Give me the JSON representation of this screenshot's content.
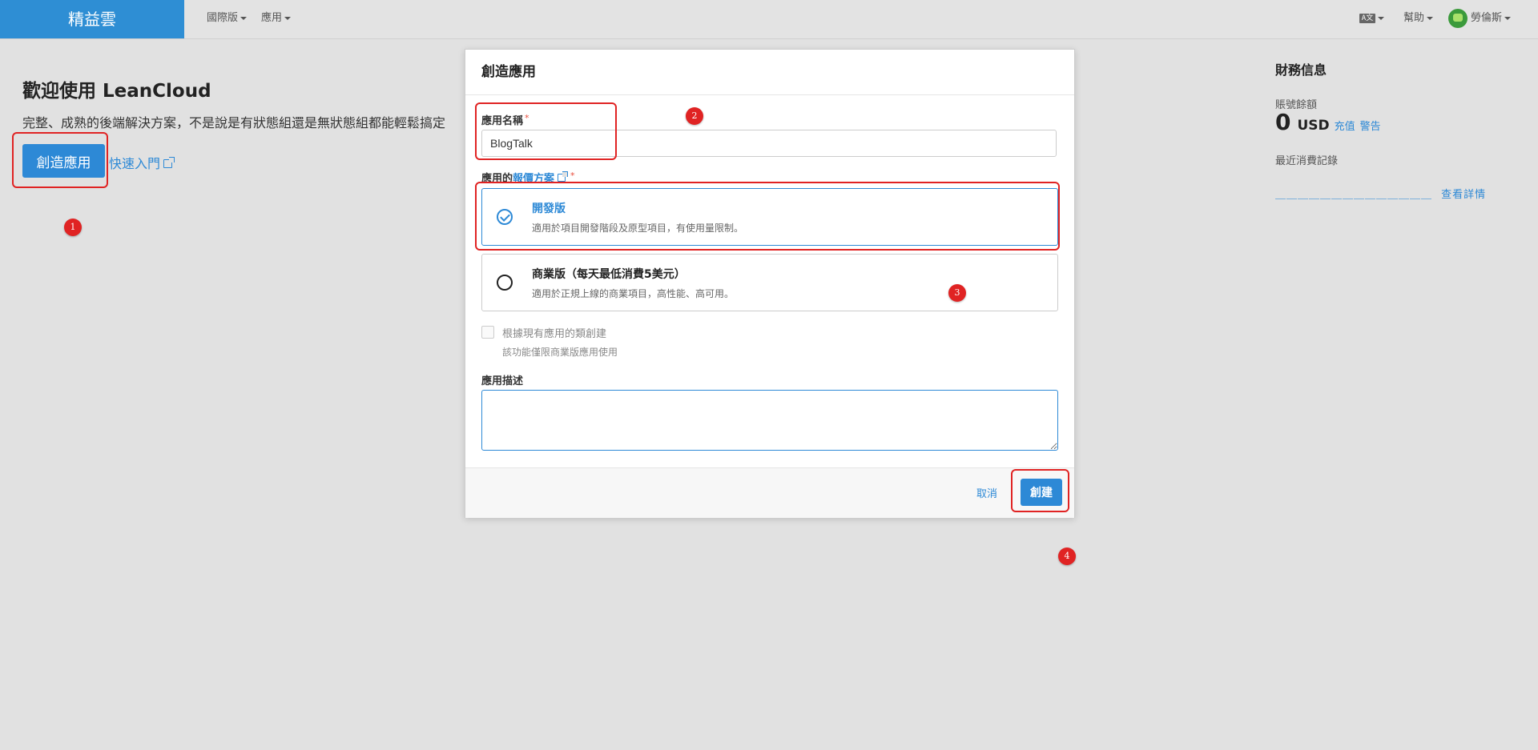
{
  "navbar": {
    "brand": "精益雲",
    "menu_region": "國際版",
    "menu_apps": "應用",
    "lang_icon": "A文",
    "menu_help": "幫助",
    "user_name": "勞倫斯"
  },
  "page": {
    "welcome_title": "歡迎使用 LeanCloud",
    "welcome_sub": "完整、成熟的後端解決方案，不是說是有狀態組還是無狀態組都能輕鬆搞定",
    "create_button": "創造應用",
    "quickstart_link": "快速入門"
  },
  "finance": {
    "title": "財務信息",
    "balance_label": "賬號餘額",
    "balance_value": "0",
    "currency": "USD",
    "recharge_link": "充值",
    "alert_link": "警告",
    "recent_label": "最近消費記錄",
    "recent_placeholder": "＿＿＿＿＿＿＿＿＿＿＿＿＿＿",
    "details_link": "查看詳情"
  },
  "modal": {
    "title": "創造應用",
    "name_label": "應用名稱",
    "required_mark": "*",
    "name_value": "BlogTalk",
    "plan_label_prefix": "應用的",
    "plan_label_link": "報價方案",
    "plans": [
      {
        "name": "開發版",
        "desc": "適用於項目開發階段及原型項目，有使用量限制。",
        "selected": true
      },
      {
        "name": "商業版（每天最低消費5美元）",
        "desc": "適用於正規上線的商業項目，高性能、高可用。",
        "selected": false
      }
    ],
    "clone_label": "根據現有應用的類創建",
    "clone_note": "該功能僅限商業版應用使用",
    "desc_label": "應用描述",
    "desc_value": "",
    "cancel_button": "取消",
    "submit_button": "創建"
  },
  "annotations": {
    "marker_1": "1",
    "marker_2": "2",
    "marker_3": "3",
    "marker_4": "4",
    "highlight_color": "#e02323"
  },
  "colors": {
    "brand": "#2e8ed4",
    "accent": "#2d89d6",
    "background": "#e1e1e1"
  }
}
